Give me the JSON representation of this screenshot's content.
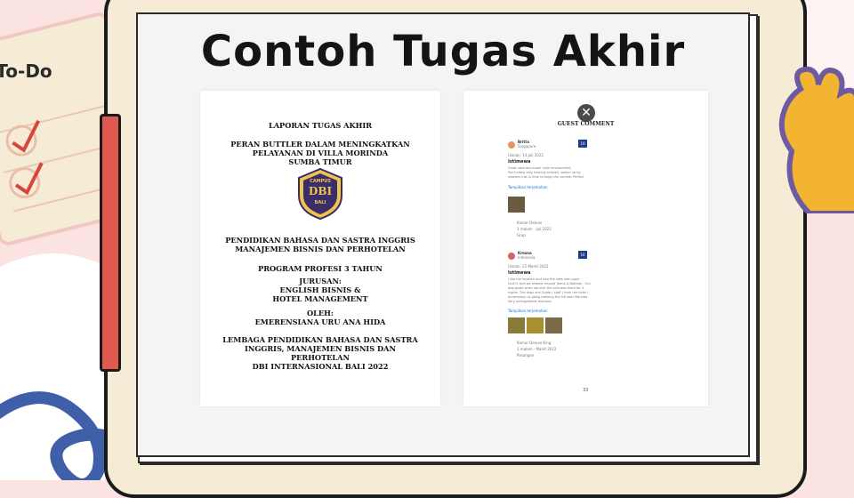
{
  "title": "Contoh Tugas Akhir",
  "todo_label": "To-Do",
  "cover": {
    "heading": "LAPORAN TUGAS AKHIR",
    "thesis_title": "PERAN BUTTLER DALAM MENINGKATKAN\nPELAYANAN DI VILLA MORINDA\nSUMBA TIMUR",
    "logo_top": "CAMPUS",
    "logo_mid": "DBI",
    "logo_bottom": "BALI",
    "department": "PENDIDIKAN BAHASA DAN SASTRA INGGRIS\nMANAJEMEN BISNIS DAN PERHOTELAN",
    "program": "PROGRAM PROFESI 3 TAHUN",
    "major": "JURUSAN:\nENGLISH BISNIS &\nHOTEL MANAGEMENT",
    "author": "OLEH:\nEMERENSIANA URU ANA HIDA",
    "institution": "LEMBAGA PENDIDIKAN BAHASA DAN SASTRA\nINGGRIS, MANAJEMEN BISNIS DAN\nPERHOTELAN\nDBI INTERNASIONAL BALI 2022"
  },
  "review_page": {
    "heading": "GUEST COMMENT",
    "page_number": "33",
    "reviews": [
      {
        "name": "Britta",
        "country": "Singapore",
        "score": "10",
        "date": "Ulasan: 14 Juli 2022",
        "headline": "Istimewa",
        "text": "Great view and super calm environment.\nYou'll sleep only hearing animals, woken up by\nroosters just in time to enjoy the sunrise. Perfect",
        "translate": "Tampilkan terjemahan",
        "room": "Kamar Deluxe",
        "stay": "1 malam · Juli 2022",
        "group": "Grup"
      },
      {
        "name": "Kresna",
        "country": "Indonesia",
        "score": "10",
        "date": "Ulasan: 21 Maret 2022",
        "headline": "Istimewa",
        "text": "I like the location and also the view was super\nnice!!! And we already missed Teena & Batman . Our\ndog guide when we visit the villa was there for 4\nnights. The dogs and Guido ( staff ) from the hotel (\naccompany us going trekking the hill near Morinda.\nVery unforgettable moment.",
        "translate": "Tampilkan terjemahan",
        "room": "Kamar Deluxe King",
        "stay": "3 malam · Maret 2022",
        "group": "Pasangan"
      }
    ]
  }
}
